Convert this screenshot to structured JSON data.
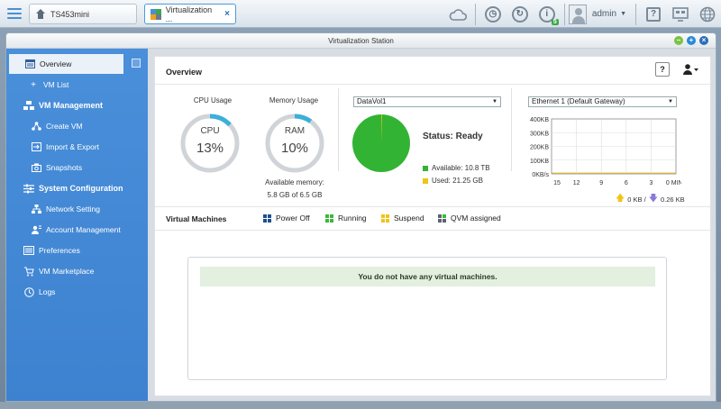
{
  "topbar": {
    "home_tab": "TS453mini",
    "active_tab": "Virtualization ...",
    "tab_close": "×",
    "admin": "admin",
    "notif_count": "5",
    "icons": [
      "menu-icon",
      "cloud-icon",
      "clock-icon",
      "refresh-icon",
      "info-icon",
      "avatar-icon",
      "help-icon",
      "monitor-icon",
      "globe-icon"
    ]
  },
  "window": {
    "title": "Virtualization Station",
    "controls": {
      "min": "–",
      "max": "+",
      "close": "×"
    }
  },
  "sidebar": {
    "items": [
      {
        "label": "Overview",
        "icon": "overview-icon",
        "level": 0
      },
      {
        "label": "VM List",
        "icon": "plus-icon",
        "level": 1
      },
      {
        "label": "VM Management",
        "icon": "vm-management-icon",
        "level": 0
      },
      {
        "label": "Create VM",
        "icon": "create-vm-icon",
        "level": 1
      },
      {
        "label": "Import & Export",
        "icon": "import-export-icon",
        "level": 1
      },
      {
        "label": "Snapshots",
        "icon": "snapshots-icon",
        "level": 1
      },
      {
        "label": "System Configuration",
        "icon": "system-config-icon",
        "level": 0
      },
      {
        "label": "Network Setting",
        "icon": "network-icon",
        "level": 1
      },
      {
        "label": "Account Management",
        "icon": "account-icon",
        "level": 1
      },
      {
        "label": "Preferences",
        "icon": "preferences-icon",
        "level": 0
      },
      {
        "label": "VM Marketplace",
        "icon": "marketplace-icon",
        "level": 0
      },
      {
        "label": "Logs",
        "icon": "logs-icon",
        "level": 0
      }
    ]
  },
  "overview": {
    "title": "Overview",
    "help": "?",
    "cpu": {
      "label": "CPU Usage",
      "name": "CPU",
      "value": "13%",
      "fraction": 0.13
    },
    "memory": {
      "label": "Memory Usage",
      "name": "RAM",
      "value": "10%",
      "fraction": 0.1,
      "available_label": "Available memory:",
      "available_value": "5.8 GB of 6.5 GB"
    },
    "storage": {
      "volume": "DataVol1",
      "status": "Status: Ready",
      "available": "Available: 10.8 TB",
      "used": "Used: 21.25 GB",
      "used_fraction": 0.002,
      "colors": {
        "available": "#33b333",
        "used": "#f0c419"
      }
    },
    "network": {
      "interface": "Ethernet 1 (Default Gateway)",
      "upload": "0 KB /",
      "download": "0.26 KB"
    }
  },
  "chart_data": {
    "type": "line",
    "y_ticks": [
      "400KB",
      "300KB",
      "200KB",
      "100KB",
      "0KB/s"
    ],
    "x_ticks": [
      "15",
      "12",
      "9",
      "6",
      "3",
      "0 MINs"
    ],
    "ylim": [
      0,
      400
    ],
    "series": [
      {
        "values": [
          0,
          0,
          0,
          0,
          0,
          0
        ]
      }
    ],
    "grid": true
  },
  "vm": {
    "title": "Virtual Machines",
    "legend": [
      {
        "label": "Power Off",
        "color": "#1f4f8f"
      },
      {
        "label": "Running",
        "color": "#3cb83c"
      },
      {
        "label": "Suspend",
        "color": "#f0c419"
      },
      {
        "label": "QVM assigned",
        "color": "#5a6470"
      }
    ],
    "empty_message": "You do not have any virtual machines."
  }
}
